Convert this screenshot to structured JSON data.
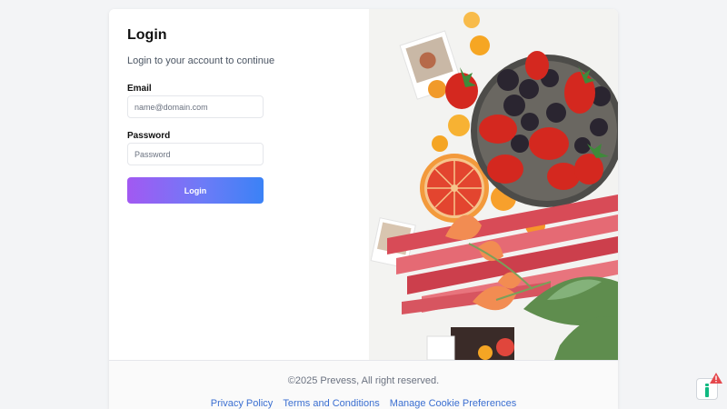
{
  "login": {
    "title": "Login",
    "subtitle": "Login to your account to continue",
    "email_label": "Email",
    "email_placeholder": "name@domain.com",
    "email_value": "",
    "password_label": "Password",
    "password_placeholder": "Password",
    "password_value": "",
    "submit_label": "Login"
  },
  "hero_image": {
    "subject": "fruit-and-rhubarb-photo"
  },
  "footer": {
    "copyright": "©2025 Prevess, All right reserved.",
    "links": [
      {
        "label": "Privacy Policy"
      },
      {
        "label": "Terms and Conditions"
      },
      {
        "label": "Manage Cookie Preferences"
      }
    ]
  },
  "cookie_widget": {
    "icon": "cookie-consent-icon",
    "alert_icon": "warning-icon"
  },
  "colors": {
    "button_gradient_start": "#a259f2",
    "button_gradient_end": "#3b82f6",
    "link": "#3b6fd1",
    "page_background": "#f3f4f6"
  }
}
